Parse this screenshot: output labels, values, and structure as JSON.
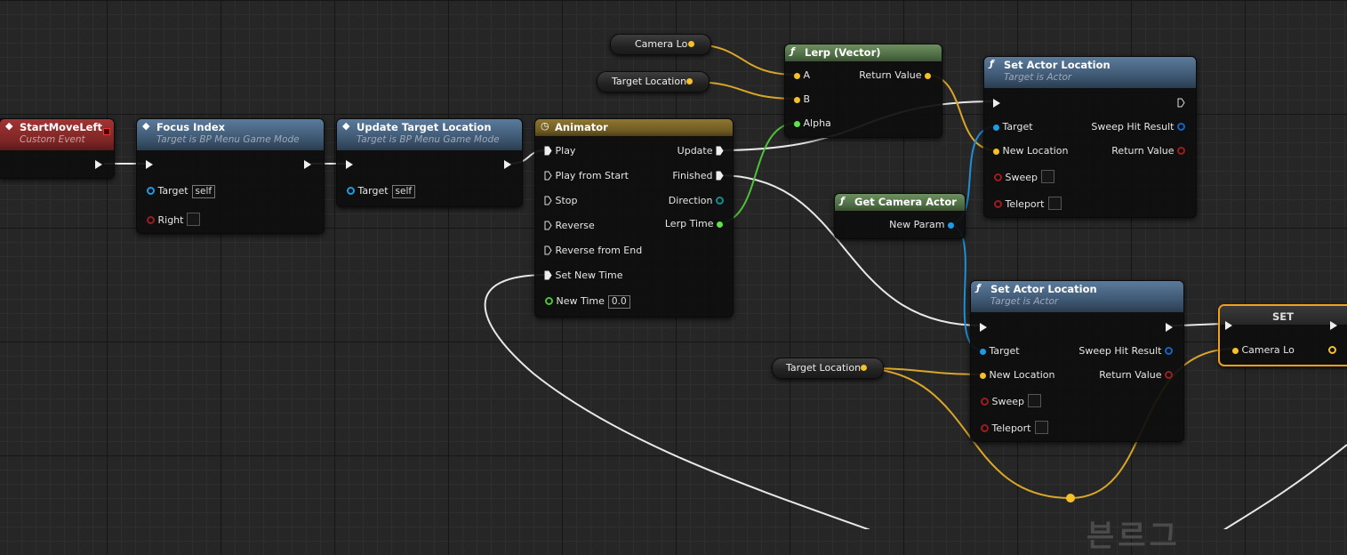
{
  "nodes": {
    "start_move_left": {
      "title": "StartMoveLeft",
      "subtitle": "Custom Event"
    },
    "focus_index": {
      "title": "Focus Index",
      "subtitle": "Target is BP Menu Game Mode",
      "target_label": "Target",
      "target_value": "self",
      "right_label": "Right"
    },
    "update_target_location": {
      "title": "Update Target Location",
      "subtitle": "Target is BP Menu Game Mode",
      "target_label": "Target",
      "target_value": "self"
    },
    "animator": {
      "title": "Animator",
      "inputs": [
        "Play",
        "Play from Start",
        "Stop",
        "Reverse",
        "Reverse from End",
        "Set New Time"
      ],
      "new_time_label": "New Time",
      "new_time_value": "0.0",
      "outputs": [
        "Update",
        "Finished",
        "Direction",
        "Lerp Time"
      ]
    },
    "lerp_vector": {
      "title": "Lerp (Vector)",
      "a_label": "A",
      "b_label": "B",
      "alpha_label": "Alpha",
      "return_label": "Return Value"
    },
    "set_actor_location_1": {
      "title": "Set Actor Location",
      "subtitle": "Target is Actor",
      "target_label": "Target",
      "new_location_label": "New Location",
      "sweep_label": "Sweep",
      "teleport_label": "Teleport",
      "sweep_hit_label": "Sweep Hit Result",
      "return_label": "Return Value"
    },
    "get_camera_actor": {
      "title": "Get Camera Actor",
      "new_param_label": "New Param"
    },
    "set_actor_location_2": {
      "title": "Set Actor Location",
      "subtitle": "Target is Actor",
      "target_label": "Target",
      "new_location_label": "New Location",
      "sweep_label": "Sweep",
      "teleport_label": "Teleport",
      "sweep_hit_label": "Sweep Hit Result",
      "return_label": "Return Value"
    },
    "set_node": {
      "title": "SET",
      "camera_label": "Camera Lo"
    }
  },
  "variables": {
    "camera_lo": "Camera Lo",
    "target_location_1": "Target Location",
    "target_location_2": "Target Location"
  },
  "watermark": "븐르그",
  "colors": {
    "exec": "#ffffff",
    "vector": "#f5c02a",
    "object": "#1e9be6",
    "bool": "#8c1c1c",
    "float": "#5ee34c"
  }
}
